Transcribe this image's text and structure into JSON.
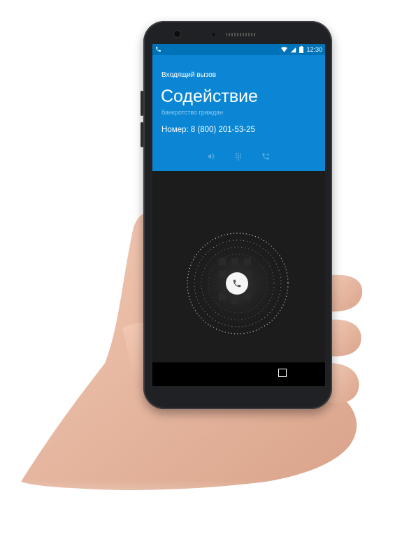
{
  "status_bar": {
    "time": "12:30",
    "icons": [
      "phone-icon",
      "wifi-icon",
      "signal-icon",
      "battery-icon"
    ]
  },
  "call": {
    "incoming_label": "Входящий вызов",
    "caller_name": "Содействие",
    "caller_subtitle": "банкротство граждан",
    "number_line": "Номер: 8 (800) 201-53-25",
    "actions": [
      "speaker-icon",
      "dialpad-icon",
      "call-forward-icon"
    ]
  },
  "answer": {
    "icon": "phone-answer-icon"
  },
  "colors": {
    "header_blue": "#0a86d4",
    "status_blue": "#0073b8",
    "subtitle_blue": "#8ec9ef",
    "screen_dark": "#1c1c1d"
  }
}
